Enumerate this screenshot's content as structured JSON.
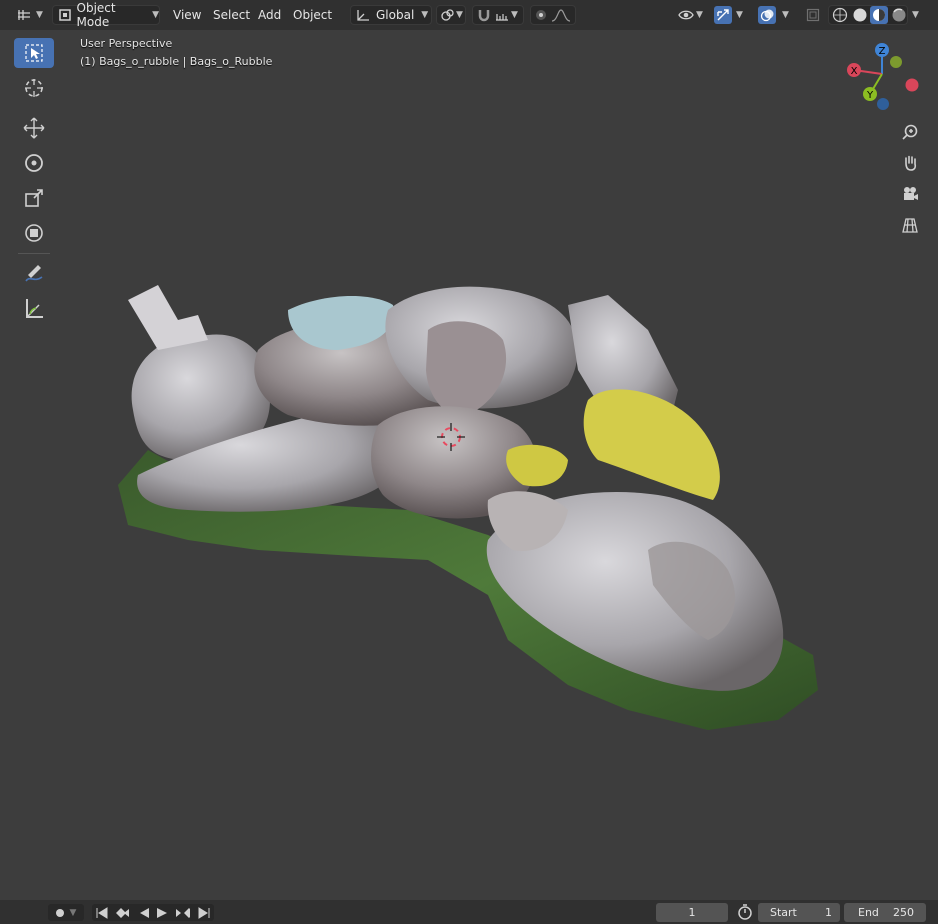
{
  "header": {
    "mode": "Object Mode",
    "menus": [
      "View",
      "Select",
      "Add",
      "Object"
    ],
    "transform_orientation": "Global"
  },
  "viewport": {
    "view_name": "User Perspective",
    "object_info": "(1) Bags_o_rubble | Bags_o_Rubble"
  },
  "gizmo": {
    "x": "X",
    "y": "Y",
    "z": "Z"
  },
  "timeline": {
    "current_frame": "1",
    "start_label": "Start",
    "start_value": "1",
    "end_label": "End",
    "end_value": "250"
  },
  "colors": {
    "accent": "#4772b3",
    "axis_x": "#d9465a",
    "axis_y": "#8cbd22",
    "axis_z": "#3f84d6"
  }
}
